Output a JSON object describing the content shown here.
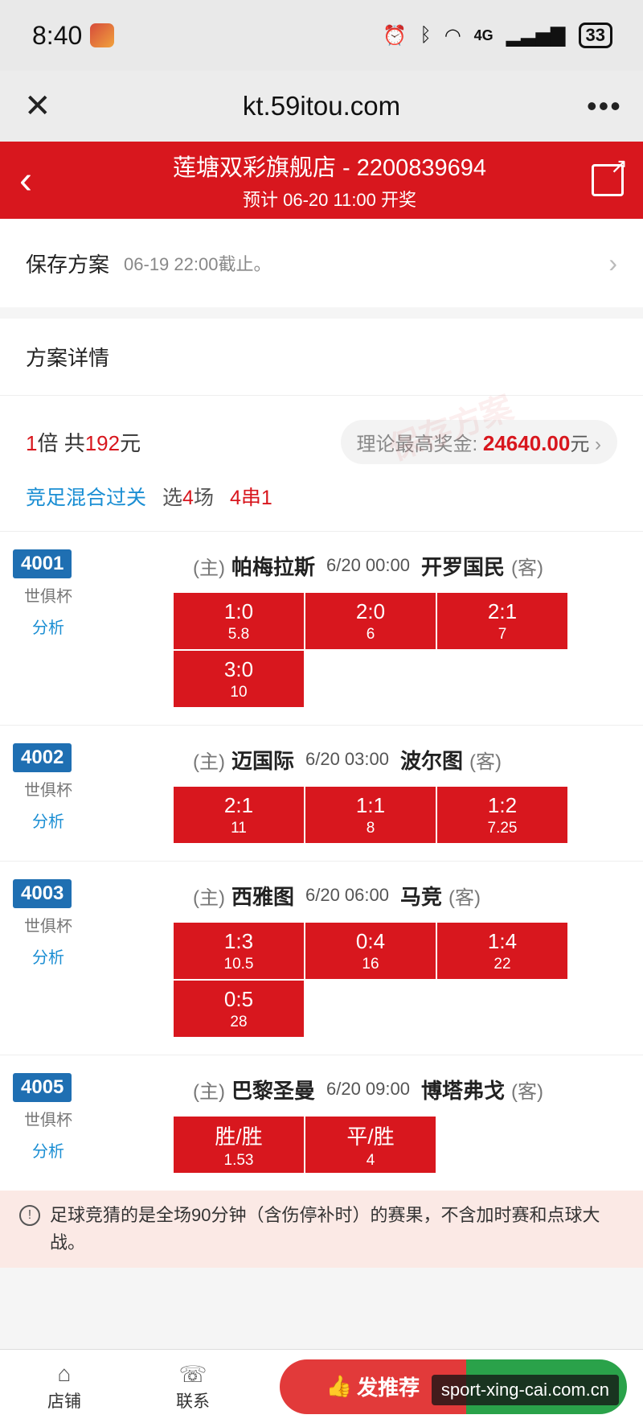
{
  "status_bar": {
    "time": "8:40",
    "network": "4G",
    "battery": "33"
  },
  "browser": {
    "url": "kt.59itou.com",
    "close_icon": "close-icon",
    "menu_icon": "more-icon"
  },
  "header": {
    "title": "莲塘双彩旗舰店 - 2200839694",
    "subtitle": "预计 06-20 11:00 开奖",
    "accent": "#d8171e"
  },
  "save_plan": {
    "label": "保存方案",
    "deadline": "06-19 22:00截止。"
  },
  "details": {
    "title": "方案详情",
    "multiplier_num": "1",
    "multiplier_unit": "倍 共",
    "total_num": "192",
    "total_unit": "元",
    "prize_label": "理论最高奖金:",
    "prize_value": "24640.00",
    "prize_unit": "元",
    "play_type": "竞足混合过关",
    "select_prefix": "选",
    "select_num": "4",
    "select_suffix": "场",
    "combo": "4串1"
  },
  "matches": [
    {
      "code": "4001",
      "league": "世俱杯",
      "analysis": "分析",
      "home_tag": "(主)",
      "home": "帕梅拉斯",
      "time": "6/20 00:00",
      "away": "开罗国民",
      "away_tag": "(客)",
      "bets": [
        {
          "label": "1:0",
          "odds": "5.8"
        },
        {
          "label": "2:0",
          "odds": "6"
        },
        {
          "label": "2:1",
          "odds": "7"
        },
        {
          "label": "3:0",
          "odds": "10"
        }
      ]
    },
    {
      "code": "4002",
      "league": "世俱杯",
      "analysis": "分析",
      "home_tag": "(主)",
      "home": "迈国际",
      "time": "6/20 03:00",
      "away": "波尔图",
      "away_tag": "(客)",
      "bets": [
        {
          "label": "2:1",
          "odds": "11"
        },
        {
          "label": "1:1",
          "odds": "8"
        },
        {
          "label": "1:2",
          "odds": "7.25"
        }
      ]
    },
    {
      "code": "4003",
      "league": "世俱杯",
      "analysis": "分析",
      "home_tag": "(主)",
      "home": "西雅图",
      "time": "6/20 06:00",
      "away": "马竞",
      "away_tag": "(客)",
      "bets": [
        {
          "label": "1:3",
          "odds": "10.5"
        },
        {
          "label": "0:4",
          "odds": "16"
        },
        {
          "label": "1:4",
          "odds": "22"
        },
        {
          "label": "0:5",
          "odds": "28"
        }
      ]
    },
    {
      "code": "4005",
      "league": "世俱杯",
      "analysis": "分析",
      "home_tag": "(主)",
      "home": "巴黎圣曼",
      "time": "6/20 09:00",
      "away": "博塔弗戈",
      "away_tag": "(客)",
      "bets": [
        {
          "label": "胜/胜",
          "odds": "1.53"
        },
        {
          "label": "平/胜",
          "odds": "4"
        }
      ]
    }
  ],
  "notice": {
    "text": "足球竞猜的是全场90分钟（含伤停补时）的赛果，不含加时赛和点球大战。"
  },
  "bottom_bar": {
    "shop_label": "店铺",
    "contact_label": "联系",
    "recommend_label": "发推荐"
  },
  "watermark_label": "sport-xing-cai.com.cn",
  "background_watermark": "保存方案"
}
